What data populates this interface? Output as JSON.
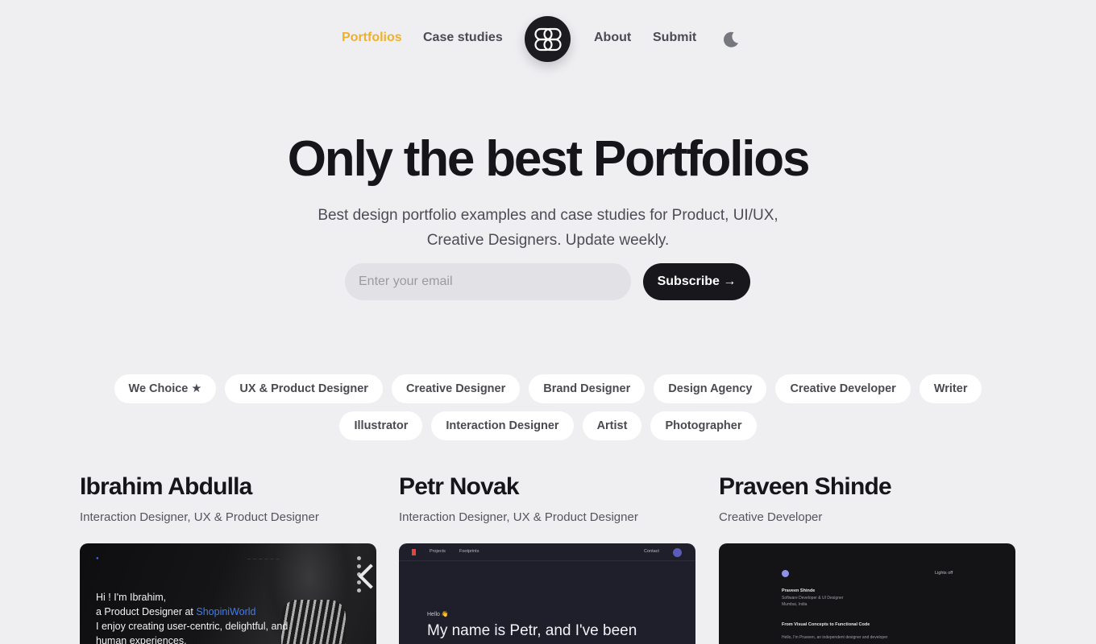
{
  "nav": {
    "links_left": [
      "Portfolios",
      "Case studies"
    ],
    "links_right": [
      "About",
      "Submit"
    ],
    "active": "Portfolios",
    "logo_icon": "logo-mark-icon",
    "theme_icon": "moon-icon"
  },
  "hero": {
    "title": "Only the best Portfolios",
    "subtitle_line1": "Best design portfolio examples and case studies for Product, UI/UX,",
    "subtitle_line2": "Creative Designers. Update weekly.",
    "email_placeholder": "Enter your email",
    "email_value": "",
    "subscribe_label": "Subscribe →"
  },
  "categories": {
    "row1": [
      "We Choice ★",
      "UX & Product Designer",
      "Creative Designer",
      "Brand Designer",
      "Design Agency",
      "Creative Developer",
      "Writer"
    ],
    "row2": [
      "Illustrator",
      "Interaction Designer",
      "Artist",
      "Photographer"
    ]
  },
  "portfolios": [
    {
      "name": "Ibrahim Abdulla",
      "role": "Interaction Designer, UX & Product Designer",
      "preview": {
        "line1": "Hi ! I'm Ibrahim,",
        "line2_prefix": "a Product Designer at ",
        "line2_highlight": "ShopiniWorld",
        "line3": "I enjoy creating user-centric, delightful, and",
        "line4": "human experiences."
      }
    },
    {
      "name": "Petr Novak",
      "role": "Interaction Designer, UX & Product Designer",
      "preview": {
        "nav1": "Projects",
        "nav2": "Footprints",
        "nav3": "Contact",
        "hello": "Hello 👋",
        "headline": "My name is Petr, and I've been"
      }
    },
    {
      "name": "Praveen Shinde",
      "role": "Creative Developer",
      "preview": {
        "toggle": "Lights off",
        "name": "Praveen Shinde",
        "title": "Software Developer & UI Designer",
        "location": "Mumbai, India",
        "heading": "From Visual Concepts to Functional Code",
        "body": "Hello, I'm Praveen, an independent designer and developer"
      }
    }
  ],
  "colors": {
    "background": "#efeff2",
    "accent": "#f0b02a",
    "dark": "#17171c",
    "chip": "#ffffff"
  }
}
